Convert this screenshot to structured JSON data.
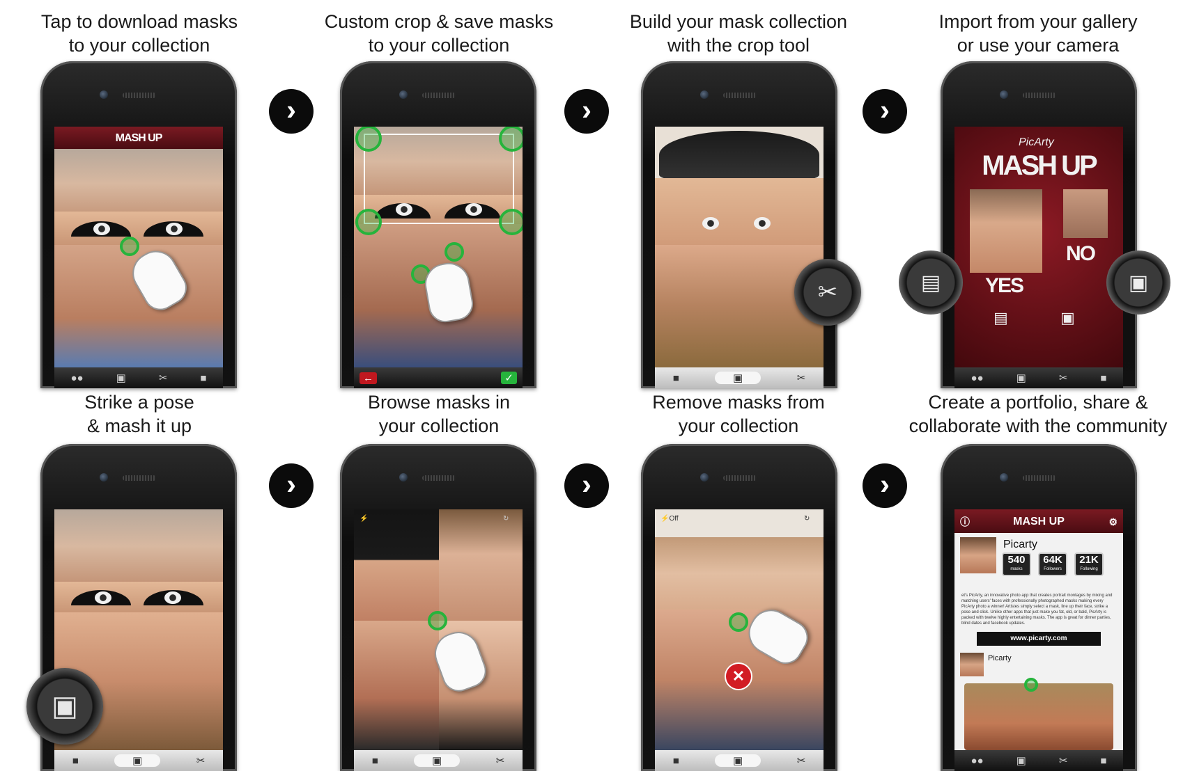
{
  "captions": [
    {
      "line1": "Tap to download masks",
      "line2": "to your collection"
    },
    {
      "line1": "Custom crop & save masks",
      "line2": "to your collection"
    },
    {
      "line1": "Build your mask collection",
      "line2": "with the crop tool"
    },
    {
      "line1": "Import from your gallery",
      "line2": "or use your camera"
    },
    {
      "line1": "Strike a pose",
      "line2": "& mash it up"
    },
    {
      "line1": "Browse masks in",
      "line2": "your collection"
    },
    {
      "line1": "Remove masks from",
      "line2": "your collection"
    },
    {
      "line1": "Create a portfolio, share &",
      "line2": "collaborate with the community"
    }
  ],
  "brand": {
    "script": "PicArty",
    "title": "MASH UP"
  },
  "import_screen": {
    "yes_label": "YES",
    "no_label": "NO"
  },
  "flash_label": "Off",
  "profile": {
    "name": "Picarty",
    "stats": [
      {
        "value": "540",
        "label": "masks"
      },
      {
        "value": "64K",
        "label": "Followers"
      },
      {
        "value": "21K",
        "label": "Following"
      }
    ],
    "bio": "et's PicArty, an innovative photo app that creates portrait montages by mixing and matching users' faces with professionally photographed masks making every PicArty photo a winner! Artistes simply select a mask, line up their face, strike a pose and click. Unlike other apps that just make you fat, old, or bald, PicArty is packed with twelve highly entertaining masks. The app is great for dinner parties, blind dates and facebook updates.",
    "url": "www.picarty.com",
    "post_author": "Picarty"
  },
  "icons": {
    "next_arrow": "chevron-right-icon",
    "community": "people-icon",
    "camera": "camera-icon",
    "crop": "scissors-icon",
    "profile": "user-icon",
    "gallery": "gallery-icon",
    "back": "back-arrow-icon",
    "confirm": "checkmark-icon",
    "delete": "close-icon",
    "settings": "gear-icon",
    "info": "info-icon",
    "flash": "flash-icon",
    "switch_camera": "switch-camera-icon"
  },
  "colors": {
    "brand_red": "#7a1a22",
    "handle_green": "#26b43c",
    "delete_red": "#d21c24"
  }
}
